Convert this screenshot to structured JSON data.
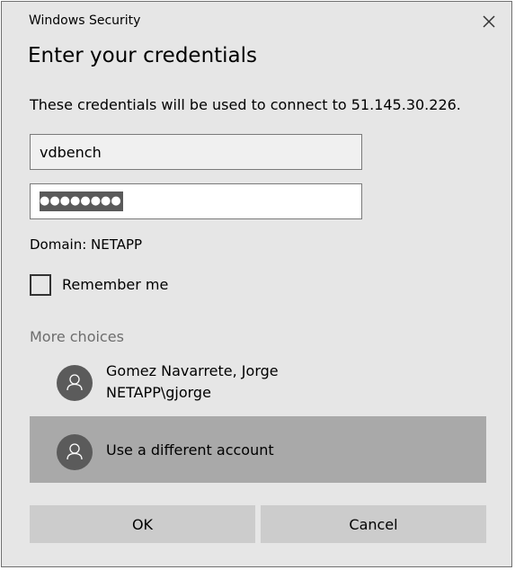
{
  "window": {
    "title": "Windows Security",
    "close_icon": "close-icon"
  },
  "dialog": {
    "heading": "Enter your credentials",
    "description": "These credentials will be used to connect to 51.145.30.226."
  },
  "credentials": {
    "username": "vdbench",
    "password_mask": "●●●●●●●●",
    "password_selected": true,
    "domain": "Domain: NETAPP"
  },
  "remember": {
    "label": "Remember me",
    "checked": false
  },
  "more_choices": {
    "label": "More choices",
    "accounts": [
      {
        "name": "Gomez Navarrete, Jorge",
        "user": "NETAPP\\gjorge",
        "icon": "user-icon"
      },
      {
        "name": "Use a different account",
        "icon": "user-icon",
        "selected": true
      }
    ]
  },
  "buttons": {
    "ok": "OK",
    "cancel": "Cancel"
  },
  "colors": {
    "dialog_background": "#e6e6e6",
    "selected_account": "#a9a9a9",
    "button": "#cccccc",
    "avatar": "#5b5b5b",
    "muted_text": "#6d6d6d"
  }
}
